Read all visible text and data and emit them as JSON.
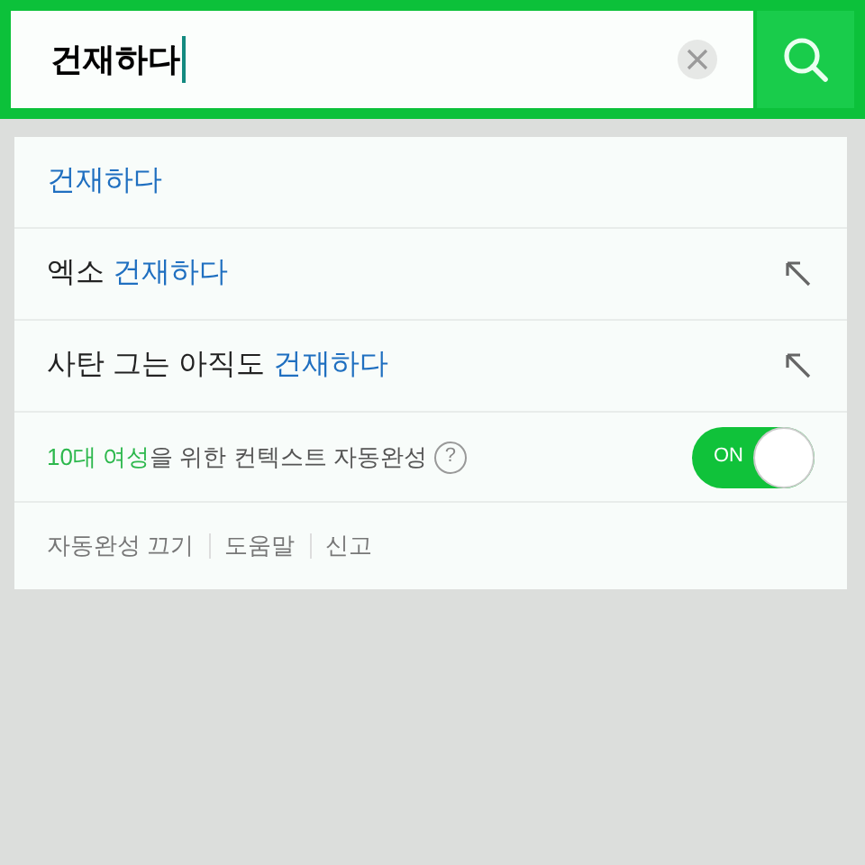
{
  "search": {
    "value": "건재하다"
  },
  "suggestions": [
    {
      "match": "건재하다",
      "fill_arrow": false
    },
    {
      "prefix": "엑소 ",
      "match": "건재하다",
      "fill_arrow": true
    },
    {
      "prefix": "사탄 그는 아직도 ",
      "match": "건재하다",
      "fill_arrow": true
    }
  ],
  "context_autocomplete": {
    "highlight": "10대 여성",
    "text": "을 위한 컨텍스트 자동완성",
    "help": "?",
    "toggle": {
      "label": "ON",
      "on": true
    }
  },
  "footer_links": [
    "자동완성 끄기",
    "도움말",
    "신고"
  ]
}
